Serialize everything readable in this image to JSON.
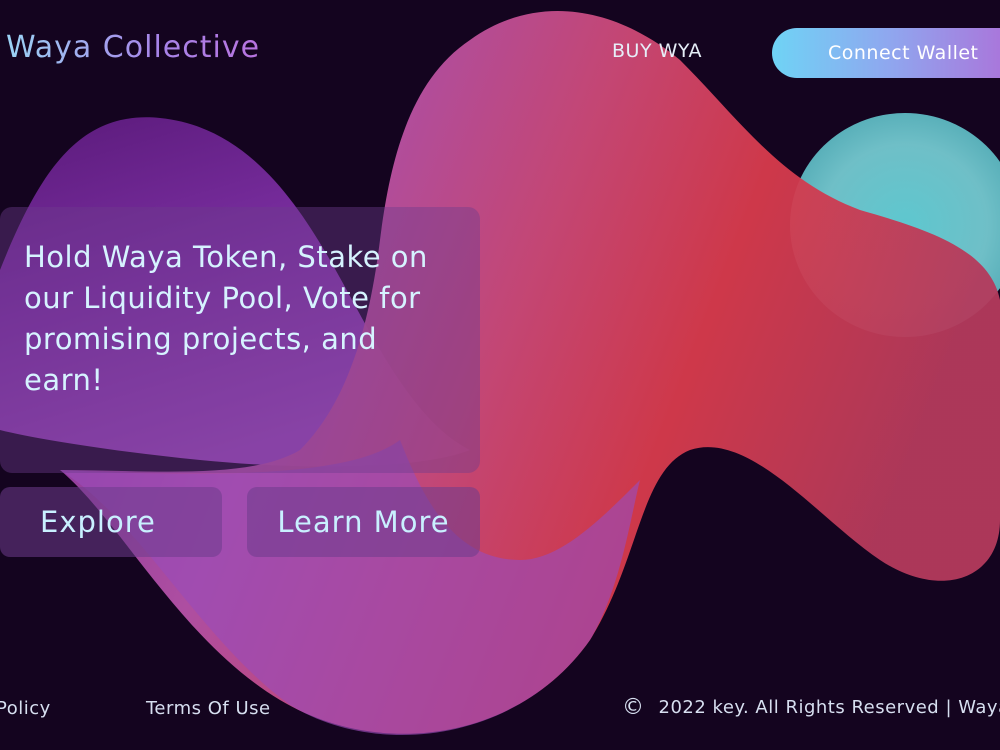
{
  "header": {
    "brand": "Waya Collective",
    "buy_link": "BUY WYA",
    "connect_button": "Connect Wallet"
  },
  "hero": {
    "headline": "Hold Waya Token, Stake on our Liquidity Pool, Vote for promising projects, and earn!",
    "explore_button": "Explore",
    "learn_more_button": "Learn More"
  },
  "footer": {
    "policy_link": "Policy",
    "terms_link": "Terms Of Use",
    "copyright_icon": "copyright-icon",
    "copyright_text": "2022 key. All Rights Reserved | Waya"
  },
  "colors": {
    "background": "#14041f",
    "blob_purple": "#7b2aa0",
    "blob_pink": "#c8467a",
    "blob_red": "#d83a4a",
    "blob_teal": "#6fc9c9",
    "accent_cyan": "#6fd3f5"
  }
}
